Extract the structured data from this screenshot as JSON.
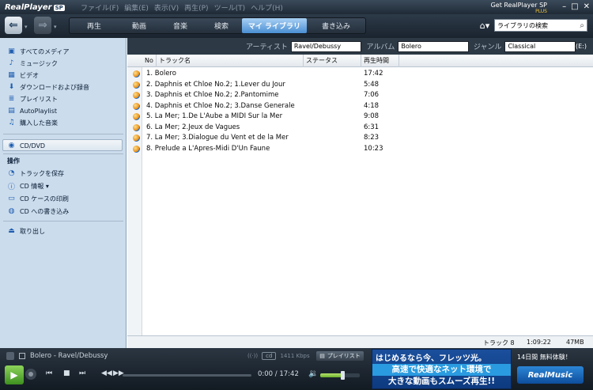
{
  "titlebar": {
    "logo": "RealPlayer",
    "logo_badge": "SP",
    "menu": [
      "ファイル(F)",
      "編集(E)",
      "表示(V)",
      "再生(P)",
      "ツール(T)",
      "ヘルプ(H)"
    ],
    "get_sp": "Get RealPlayer SP",
    "get_sp_plus": "PLUS",
    "min": "–",
    "max": "□",
    "close": "✕"
  },
  "nav": {
    "tabs": [
      "再生",
      "動画",
      "音楽",
      "検索",
      "マイ ライブラリ",
      "書き込み"
    ],
    "active_tab": 4,
    "search_placeholder": "ライブラリの検索"
  },
  "sidebar": {
    "library": [
      {
        "label": "すべてのメディア",
        "icon": "media-icon"
      },
      {
        "label": "ミュージック",
        "icon": "music-note-icon"
      },
      {
        "label": "ビデオ",
        "icon": "video-icon"
      },
      {
        "label": "ダウンロードおよび録音",
        "icon": "download-icon"
      },
      {
        "label": "プレイリスト",
        "icon": "playlist-icon"
      },
      {
        "label": "AutoPlaylist",
        "icon": "autoplaylist-icon"
      },
      {
        "label": "購入した音楽",
        "icon": "purchased-music-icon"
      }
    ],
    "cd": "CD/DVD",
    "actions_heading": "操作",
    "actions": [
      {
        "label": "トラックを保存",
        "icon": "save-track-icon"
      },
      {
        "label": "CD 情報 ▾",
        "icon": "info-icon"
      },
      {
        "label": "CD ケースの印刷",
        "icon": "print-icon"
      },
      {
        "label": "CD への書き込み",
        "icon": "burn-cd-icon"
      }
    ],
    "eject": "取り出し"
  },
  "filter": {
    "artist_label": "アーティスト",
    "artist_value": "Ravel/Debussy",
    "album_label": "アルバム",
    "album_value": "Bolero",
    "genre_label": "ジャンル",
    "genre_value": "Classical",
    "drive": "(E:)"
  },
  "table": {
    "headers": [
      "No",
      "トラック名",
      "ステータス",
      "再生時間"
    ],
    "rows": [
      {
        "name": "1.  Bolero",
        "time": "17:42"
      },
      {
        "name": "2.  Daphnis et Chloe No.2; 1.Lever du Jour",
        "time": "5:48"
      },
      {
        "name": "3.  Daphnis et Chloe No.2; 2.Pantomime",
        "time": "7:06"
      },
      {
        "name": "4.  Daphnis et Chloe No.2; 3.Danse Generale",
        "time": "4:18"
      },
      {
        "name": "5.  La Mer; 1.De L'Aube a MIDI Sur la Mer",
        "time": "9:08"
      },
      {
        "name": "6.  La Mer; 2.Jeux de Vagues",
        "time": "6:31"
      },
      {
        "name": "7.  La Mer; 3.Dialogue du Vent et de la Mer",
        "time": "8:23"
      },
      {
        "name": "8.  Prelude a L'Apres-Midi D'Un Faune",
        "time": "10:23"
      }
    ]
  },
  "status": {
    "tracks": "トラック 8",
    "duration": "1:09:22",
    "size": "47MB"
  },
  "player": {
    "now_playing": "Bolero - Ravel/Debussy",
    "source": "cd",
    "bitrate": "1411 Kbps",
    "playlist_button": "プレイリスト",
    "time": "0:00 / 17:42",
    "volume_percent": 55
  },
  "ad": {
    "line1": "はじめるなら今、フレッツ光。",
    "line2": "高速で快適なネット環境で",
    "line3": "大きな動画もスムーズ再生!!"
  },
  "trial": "14日間  無料体験！",
  "realmusic": "RealMusic"
}
